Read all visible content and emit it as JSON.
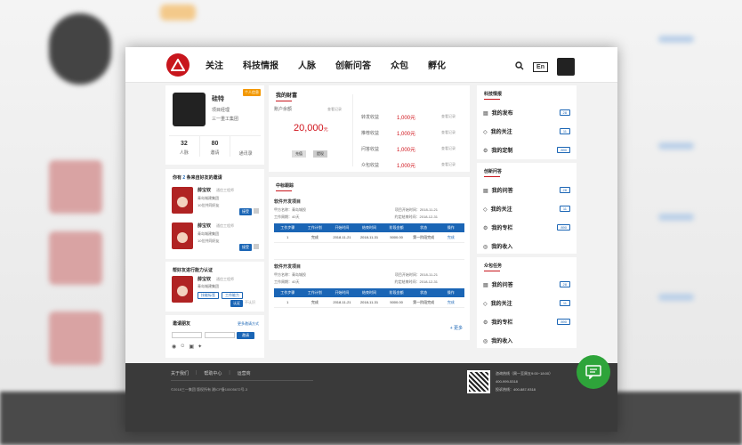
{
  "nav": {
    "items": [
      "关注",
      "科技情报",
      "人脉",
      "创新问答",
      "众包",
      "孵化"
    ],
    "lang": "En"
  },
  "profile": {
    "tag": "个人信息",
    "name": "硅特",
    "role": "项目经理",
    "company": "三一重工集团",
    "stats": [
      {
        "value": "32",
        "label": "人脉"
      },
      {
        "value": "80",
        "label": "邀请"
      },
      {
        "value": "",
        "label": "通讯录"
      }
    ]
  },
  "invites": {
    "title_prefix": "你有",
    "count": "2",
    "title_suffix": "条来自好友的邀请",
    "items": [
      {
        "name": "薛宝钗",
        "job": "通信工程师",
        "company": "青岛城建集团",
        "mutual": "10位共同好友",
        "action": "接受"
      },
      {
        "name": "薛宝钗",
        "job": "通信工程师",
        "company": "青岛城建集团",
        "mutual": "10位共同好友",
        "action": "接受"
      }
    ]
  },
  "certify": {
    "title": "帮好友进行能力认证",
    "name": "薛宝钗",
    "job": "通信工程师",
    "company": "青岛城建集团",
    "tags": [
      "技能标签",
      "工作能力"
    ],
    "action": "认证",
    "skip": "不认识"
  },
  "invite_friends": {
    "title": "邀请朋友",
    "more": "更多邀请方式",
    "placeholder": "",
    "button": "邀请"
  },
  "wealth": {
    "title": "我的财富",
    "balance_label": "账户余额",
    "view_record": "查看记录",
    "balance": "20,000",
    "unit": "元",
    "btn_recharge": "充值",
    "btn_withdraw": "提现",
    "rows": [
      {
        "label": "转发收益",
        "value": "1,000元",
        "link": "查看记录"
      },
      {
        "label": "推荐收益",
        "value": "1,000元",
        "link": "查看记录"
      },
      {
        "label": "问答收益",
        "value": "1,000元",
        "link": "查看记录"
      },
      {
        "label": "众包收益",
        "value": "1,000元",
        "link": "查看记录"
      }
    ]
  },
  "bids": {
    "title": "中标跟踪",
    "projects": [
      {
        "name": "软件开发项目",
        "client": "甲方名称：青岛城投",
        "period": "工作周期：40天",
        "start": "项目开始时间：2018-11-21",
        "end": "约定结束时间：2018-12-31",
        "columns": [
          "工作步骤",
          "工作计划",
          "开始时间",
          "结束时间",
          "阶段金额",
          "状态",
          "操作"
        ],
        "row": [
          "1",
          "完成",
          "2018-11-21",
          "2018-11-31",
          "5000.00",
          "第一阶段完成",
          "完成"
        ]
      },
      {
        "name": "软件开发项目",
        "client": "甲方名称：青岛城投",
        "period": "工作周期：40天",
        "start": "项目开始时间：2018-11-21",
        "end": "约定结束时间：2018-12-31",
        "columns": [
          "工作步骤",
          "工作计划",
          "开始时间",
          "结束时间",
          "阶段金额",
          "状态",
          "操作"
        ],
        "row": [
          "1",
          "完成",
          "2018-11-21",
          "2018-11-31",
          "5000.00",
          "第一阶段完成",
          "完成"
        ]
      }
    ],
    "more": "+ 更多"
  },
  "right": {
    "sections": [
      {
        "title": "科技情报",
        "items": [
          {
            "label": "我的发布",
            "count": "28",
            "icon": "doc-icon"
          },
          {
            "label": "我的关注",
            "count": "11",
            "icon": "diamond-icon"
          },
          {
            "label": "我的定制",
            "count": "890",
            "icon": "gear-icon"
          }
        ]
      },
      {
        "title": "创新问答",
        "items": [
          {
            "label": "我的问答",
            "count": "28",
            "icon": "doc-icon"
          },
          {
            "label": "我的关注",
            "count": "11",
            "icon": "diamond-icon"
          },
          {
            "label": "我的专栏",
            "count": "890",
            "icon": "gear-icon"
          },
          {
            "label": "我的收入",
            "count": "",
            "icon": "coin-icon"
          }
        ]
      },
      {
        "title": "众包任务",
        "items": [
          {
            "label": "我的问答",
            "count": "28",
            "icon": "doc-icon"
          },
          {
            "label": "我的关注",
            "count": "11",
            "icon": "diamond-icon"
          },
          {
            "label": "我的专栏",
            "count": "890",
            "icon": "gear-icon"
          },
          {
            "label": "我的收入",
            "count": "",
            "icon": "coin-icon"
          }
        ]
      }
    ]
  },
  "footer": {
    "links": [
      "关于我们",
      "帮助中心",
      "运营商"
    ],
    "copyright": "©2018三一集团 版权所有 湘ICP备10005672号-3",
    "hotline": "咨询热线（周一至周五9:00~18:00）",
    "hotline_num": "400-999-5318",
    "complaint": "投诉热线：400-887-9318"
  },
  "colors": {
    "accent": "#1a65b5",
    "brand": "#c8161d",
    "chat": "#2ea43a"
  }
}
